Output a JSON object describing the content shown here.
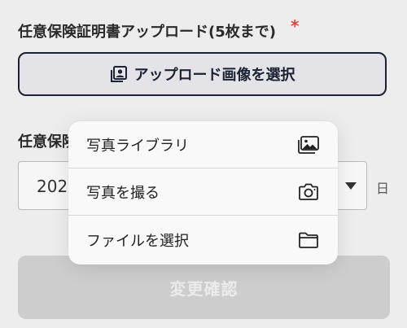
{
  "form": {
    "upload_label": "任意保険証明書アップロード(5枚まで)",
    "required_mark": "*",
    "upload_button_label": "アップロード画像を選択",
    "expiry_label_visible": "任意保険",
    "date_value": "202",
    "day_unit": "日",
    "confirm_button_label": "変更確認"
  },
  "menu": {
    "items": [
      {
        "label": "写真ライブラリ",
        "icon": "photo-library-icon"
      },
      {
        "label": "写真を撮る",
        "icon": "camera-icon"
      },
      {
        "label": "ファイルを選択",
        "icon": "folder-icon"
      }
    ]
  },
  "colors": {
    "accent_border": "#1b2233",
    "required": "#e0443c",
    "disabled_button": "#cdcdcd"
  }
}
